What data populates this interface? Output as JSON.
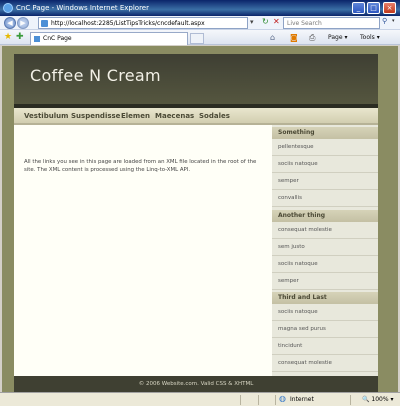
{
  "window": {
    "title": "CnC Page - Windows Internet Explorer"
  },
  "browser": {
    "address": "http://localhost:2285/ListTipsTricks/cncdefault.aspx",
    "search_placeholder": "Live Search",
    "tab_title": "CnC Page",
    "commands": {
      "page": "Page",
      "tools": "Tools"
    }
  },
  "page": {
    "site_title": "Coffee N Cream",
    "nav": [
      "Vestibulum",
      "Suspendisse",
      "Elemen",
      "Maecenas",
      "Sodales"
    ],
    "content_text": "All the links you see in this page are loaded from an XML file located in the root of the site. The XML content is processed using the Linq-to-XML API.",
    "sidebar": {
      "sections": [
        {
          "heading": "Something",
          "items": [
            "pellentesque",
            "sociis natoque",
            "semper",
            "convallis"
          ]
        },
        {
          "heading": "Another thing",
          "items": [
            "consequat molestie",
            "sem justo",
            "sociis natoque",
            "semper"
          ]
        },
        {
          "heading": "Third and Last",
          "items": [
            "sociis natoque",
            "magna sed purus",
            "tincidunt",
            "consequat molestie"
          ]
        }
      ]
    },
    "footer": "© 2006 Website.com. Valid CSS & XHTML"
  },
  "status": {
    "zone": "Internet",
    "zoom": "100%"
  },
  "colors": {
    "header_bg": "#4a4b3a",
    "nav_bg": "#dcd8bc",
    "content_bg": "#fffff7",
    "sidebar_bg": "#e8e8dc",
    "frame_bg": "#8a8c62"
  }
}
